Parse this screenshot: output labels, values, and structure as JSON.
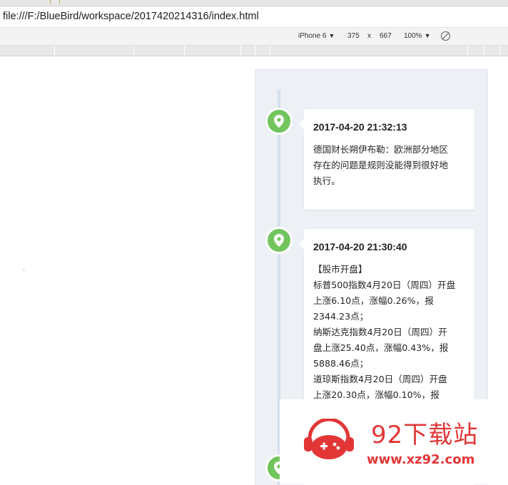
{
  "address_bar": {
    "url": "file:///F:/BlueBird/workspace/2017420214316/index.html"
  },
  "device_toolbar": {
    "device": "iPhone 6",
    "width": "375",
    "times": "x",
    "height": "667",
    "zoom": "100%"
  },
  "timeline": {
    "entries": [
      {
        "time": "2017-04-20 21:32:13",
        "lines": [
          "德国财长朔伊布勒：欧洲部分地区",
          "存在的问题是规则没能得到很好地",
          "执行。"
        ]
      },
      {
        "time": "2017-04-20 21:30:40",
        "lines": [
          "【股市开盘】",
          "标普500指数4月20日（周四）开盘",
          "上涨6.10点，涨幅0.26%，报",
          "2344.23点；",
          "纳斯达克指数4月20日（周四）开",
          "盘上涨25.40点，涨幅0.43%，报",
          "5888.46点；",
          "道琼斯指数4月20日（周四）开盘",
          "上涨20.30点，涨幅0.10%，报"
        ]
      }
    ]
  },
  "watermark": {
    "title": "92下载站",
    "url": "www.xz92.com"
  },
  "colors": {
    "marker": "#72c55e",
    "viewport_bg": "#edf0f5",
    "watermark": "#e23636"
  }
}
